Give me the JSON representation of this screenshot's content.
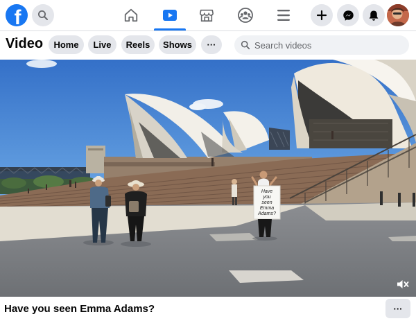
{
  "app": {
    "logo_icon": "facebook-logo-icon",
    "brand_color": "#1877f2"
  },
  "topnav": {
    "left": {
      "search_icon": "search-icon"
    },
    "tabs": [
      {
        "icon": "home-icon",
        "active": false
      },
      {
        "icon": "video-icon",
        "active": true
      },
      {
        "icon": "marketplace-icon",
        "active": false
      },
      {
        "icon": "groups-icon",
        "active": false
      },
      {
        "icon": "menu-icon",
        "active": false
      }
    ],
    "right": [
      "create-icon",
      "messenger-icon",
      "notifications-icon",
      "avatar"
    ]
  },
  "video_page": {
    "title": "Video",
    "pills": [
      "Home",
      "Live",
      "Reels",
      "Shows"
    ],
    "more_label": "···",
    "search_placeholder": "Search videos"
  },
  "video": {
    "sign_text": [
      "Have",
      "you",
      "seen",
      "Emma",
      "Adams?"
    ],
    "volume_icon": "muted-speaker-icon",
    "caption": "Have you seen Emma Adams?",
    "caption_more_label": "···"
  }
}
